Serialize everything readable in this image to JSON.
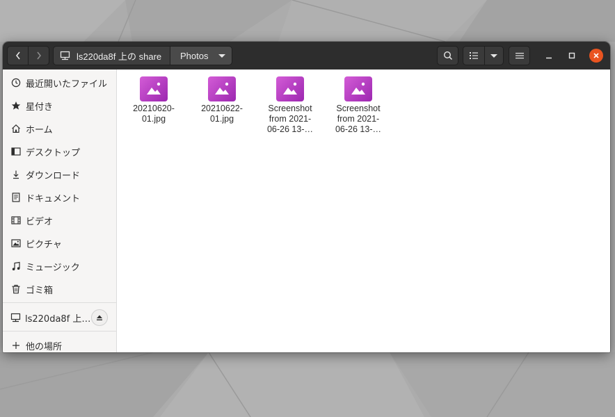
{
  "window": {
    "path_root": "ls220da8f 上の share",
    "path_current": "Photos"
  },
  "icons": {
    "back": "chevron-left-icon",
    "forward": "chevron-right-icon",
    "network": "network-drive-icon",
    "search": "search-icon",
    "view": "list-view-icon",
    "menu": "hamburger-menu-icon",
    "minimize": "minimize-icon",
    "maximize": "maximize-icon",
    "close": "close-icon"
  },
  "sidebar": {
    "items": [
      {
        "label": "最近開いたファイル",
        "icon": "clock-icon"
      },
      {
        "label": "星付き",
        "icon": "star-icon"
      },
      {
        "label": "ホーム",
        "icon": "home-icon"
      },
      {
        "label": "デスクトップ",
        "icon": "desktop-icon"
      },
      {
        "label": "ダウンロード",
        "icon": "download-icon"
      },
      {
        "label": "ドキュメント",
        "icon": "document-icon"
      },
      {
        "label": "ビデオ",
        "icon": "video-icon"
      },
      {
        "label": "ピクチャ",
        "icon": "picture-icon"
      },
      {
        "label": "ミュージック",
        "icon": "music-icon"
      },
      {
        "label": "ゴミ箱",
        "icon": "trash-icon"
      }
    ],
    "mount": {
      "label": "ls220da8f 上…",
      "icon": "network-drive-icon"
    },
    "other": {
      "label": "他の場所",
      "icon": "plus-icon"
    }
  },
  "files": [
    {
      "name": "20210620-\n01.jpg",
      "icon": "image-file-icon"
    },
    {
      "name": "20210622-\n01.jpg",
      "icon": "image-file-icon"
    },
    {
      "name": "Screenshot\nfrom 2021-\n06-26 13-…",
      "icon": "image-file-icon"
    },
    {
      "name": "Screenshot\nfrom 2021-\n06-26 13-…",
      "icon": "image-file-icon"
    }
  ],
  "colors": {
    "headerbar": "#2d2d2d",
    "close_button": "#e95420",
    "file_icon": "#b040c0",
    "sidebar_bg": "#f6f5f4"
  }
}
